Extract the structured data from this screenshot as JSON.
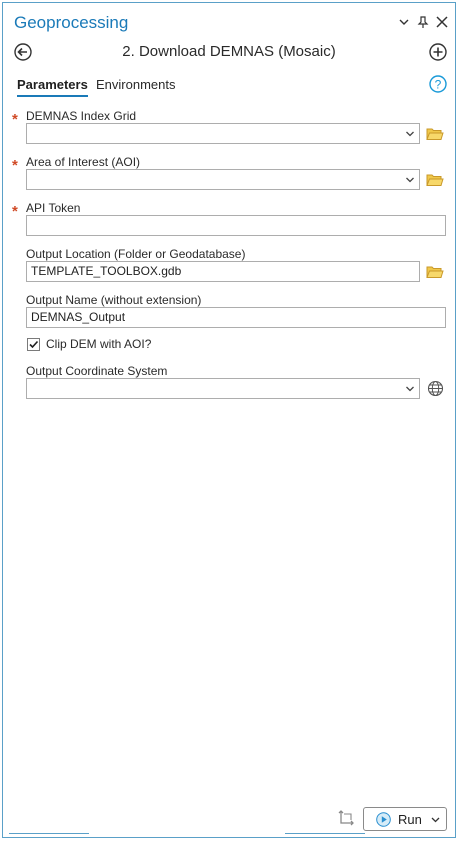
{
  "pane": {
    "title": "Geoprocessing",
    "controls": {
      "menu_icon": "chevron-down-icon",
      "pin_icon": "pin-icon",
      "close_icon": "close-icon"
    }
  },
  "tool": {
    "title": "2. Download DEMNAS (Mosaic)",
    "back_icon": "back-arrow-icon",
    "add_icon": "add-icon"
  },
  "tabs": [
    {
      "label": "Parameters",
      "active": true
    },
    {
      "label": "Environments",
      "active": false
    }
  ],
  "help_icon": "help-icon",
  "parameters": [
    {
      "label": "DEMNAS Index Grid",
      "required": true,
      "value": "",
      "has_dropdown": true,
      "has_browse": true
    },
    {
      "label": "Area of Interest (AOI)",
      "required": true,
      "value": "",
      "has_dropdown": true,
      "has_browse": true
    },
    {
      "label": "API Token",
      "required": true,
      "value": "",
      "has_dropdown": false,
      "has_browse": false
    },
    {
      "label": "Output Location (Folder or Geodatabase)",
      "required": false,
      "value": "TEMPLATE_TOOLBOX.gdb",
      "has_dropdown": false,
      "has_browse": true
    },
    {
      "label": "Output Name (without extension)",
      "required": false,
      "value": "DEMNAS_Output",
      "has_dropdown": false,
      "has_browse": false
    },
    {
      "label": "Output Coordinate System",
      "required": false,
      "value": "",
      "has_dropdown": true,
      "has_globe": true
    }
  ],
  "checkbox": {
    "label": "Clip DEM with AOI?",
    "checked": true
  },
  "footer": {
    "run_label": "Run"
  },
  "colors": {
    "accent": "#1a7ab8",
    "required": "#d04a26",
    "folder": "#d9b03c",
    "border": "#adadad"
  }
}
